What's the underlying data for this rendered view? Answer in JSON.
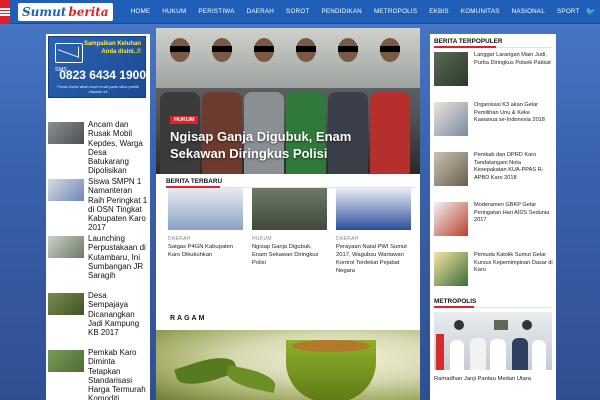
{
  "header": {
    "menu_icon": "hamburger-icon",
    "logo": {
      "part1": "Sumut",
      "part2": "berita"
    },
    "nav": [
      "HOME",
      "HUKUM",
      "PERISTIWA",
      "DAERAH",
      "SOROT",
      "PENDIDIKAN",
      "METROPOLIS",
      "EKBIS",
      "KOMUNITAS",
      "NASIONAL",
      "SPORT"
    ],
    "social": [
      "twitter-icon",
      "facebook-icon",
      "instagram-icon"
    ],
    "social_glyphs": [
      "🐦",
      "f",
      "◎"
    ]
  },
  "ad": {
    "line1": "Sampaikan Keluhan",
    "line2": "Anda disini..!!",
    "sms_label": "SMS",
    "phone": "0823 6434 1900",
    "footer": "Pesan Anda akan kami muat pada situs publik ditawah ini"
  },
  "left_list": [
    {
      "title": "Ancam dan Rusak Mobil Kepdes, Warga Desa Batukarang Dipolisikan"
    },
    {
      "title": "Siswa SMPN 1 Namanteran Raih Peringkat 1 di OSN Tingkat Kabupaten Karo 2017"
    },
    {
      "title": "Launching Perpustakaan di Kutambaru, Ini Sumbangan JR Saragih"
    },
    {
      "title": "Desa Sempajaya Dicanangkan Jadi Kampung KB 2017"
    },
    {
      "title": "Pemkab Karo Diminta Tetapkan Standarisasi Harga Termurah Komoditi Pertanian"
    }
  ],
  "hero": {
    "tag": "HUKUM",
    "title": "Ngisap Ganja Digubuk, Enam Sekawan Diringkus Polisi"
  },
  "berita_terbaru": {
    "heading": "BERITA TERBARU",
    "cards": [
      {
        "category": "DAERAH",
        "title": "Satgas P4GN Kabupaten Karo Dikukuhkan"
      },
      {
        "category": "HUKUM",
        "title": "Ngisap Ganja Digubuk, Enam Sekawan Diringkus Polisi"
      },
      {
        "category": "DAERAH",
        "title": "Perayaan Natal PWI Sumut 2017, Wagubsu Wartawan Kontrol Terdekat Pejabat Negara"
      }
    ]
  },
  "ragam": {
    "heading": "RAGAM"
  },
  "right": {
    "heading": "BERITA TERPOPULER",
    "items": [
      {
        "title": "Langgar Larangan Main Judi, Purba Diringkus Polsek Pakkat"
      },
      {
        "title": "Organisasi K3 akan Gelar Pemilihan Unu & Keke Kawanua se-Indonesia 2018"
      },
      {
        "title": "Pemkab dan DPRD Karo Tandatangani Nota Kesepakatan KUA-PPAS R-APBD Karo 2018"
      },
      {
        "title": "Moderamen GBKP Gelar Peringatan Hari AIDS Sedunia 2017"
      },
      {
        "title": "Pemuda Katolik Sumut Gelar Kursus Kepemimpinan Dasar di Karo"
      }
    ],
    "metro_heading": "METROPOLIS",
    "metro_caption": "Ramadhan Janji Pantau Medan Utara"
  }
}
